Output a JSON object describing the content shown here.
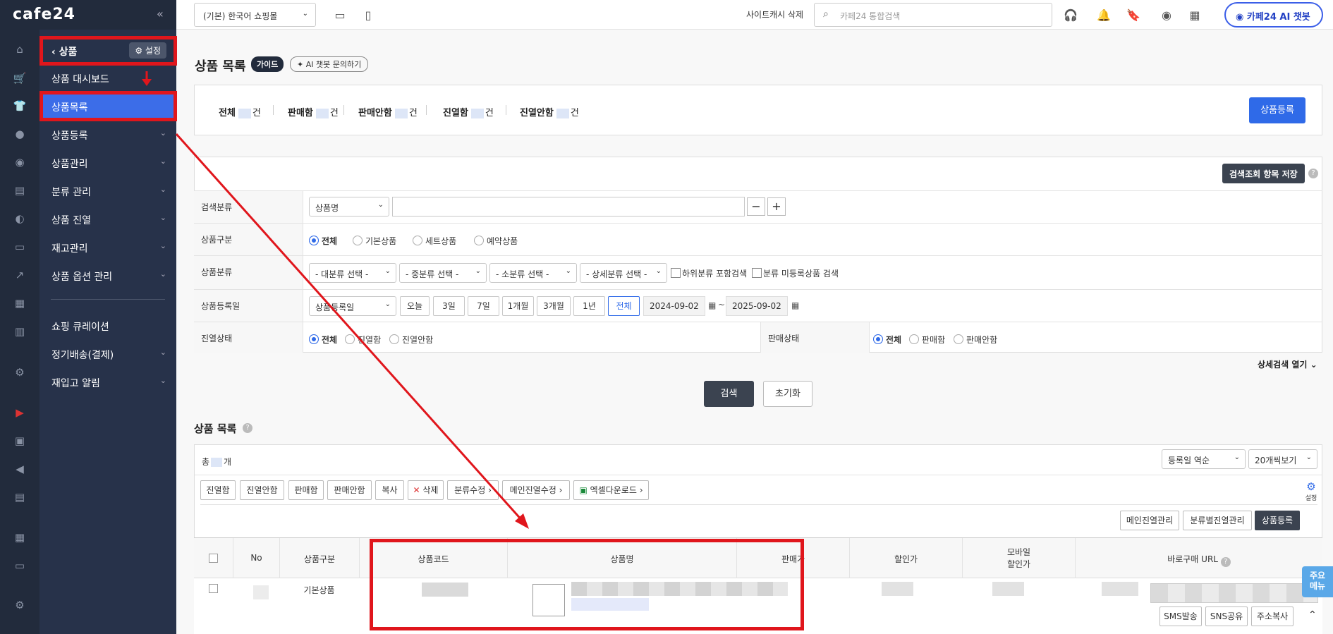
{
  "logo": "cafe24",
  "collapse_icon": "«",
  "topbar": {
    "shop_select": "(기본) 한국어 쇼핑몰",
    "cache_delete": "사이트캐시 삭제",
    "search_placeholder": "카페24 통합검색",
    "chatbot": "카페24 AI 챗봇"
  },
  "sidebar": {
    "header": "상품",
    "settings": "설정",
    "items": [
      {
        "label": "상품 대시보드"
      },
      {
        "label": "상품목록"
      },
      {
        "label": "상품등록"
      },
      {
        "label": "상품관리"
      },
      {
        "label": "분류 관리"
      },
      {
        "label": "상품 진열"
      },
      {
        "label": "재고관리"
      },
      {
        "label": "상품 옵션 관리"
      },
      {
        "label": "쇼핑 큐레이션"
      },
      {
        "label": "정기배송(결제)"
      },
      {
        "label": "재입고 알림"
      }
    ]
  },
  "page": {
    "title": "상품 목록",
    "guide": "가이드",
    "ai_chat": "AI 챗봇 문의하기"
  },
  "summary": {
    "total": "전체",
    "on_sale": "판매함",
    "not_on_sale": "판매안함",
    "displayed": "진열함",
    "not_displayed": "진열안함",
    "unit": "건",
    "register_button": "상품등록"
  },
  "search": {
    "save_button": "검색조회 항목 저장",
    "row_category_label": "검색분류",
    "category_select": "상품명",
    "row_type_label": "상품구분",
    "types": [
      "전체",
      "기본상품",
      "세트상품",
      "예약상품"
    ],
    "row_class_label": "상품분류",
    "class_selects": [
      "- 대분류 선택 -",
      "- 중분류 선택 -",
      "- 소분류 선택 -",
      "- 상세분류 선택 -"
    ],
    "include_sub": "하위분류 포함검색",
    "unclassified": "분류 미등록상품 검색",
    "row_date_label": "상품등록일",
    "date_select": "상품등록일",
    "periods": [
      "오늘",
      "3일",
      "7일",
      "1개월",
      "3개월",
      "1년",
      "전체"
    ],
    "date_from": "2024-09-02",
    "tilde": "~",
    "date_to": "2025-09-02",
    "row_display_label": "진열상태",
    "display_opts": [
      "전체",
      "진열함",
      "진열안함"
    ],
    "sale_label": "판매상태",
    "sale_opts": [
      "전체",
      "판매함",
      "판매안함"
    ],
    "advanced": "상세검색 열기",
    "search_button": "검색",
    "reset_button": "초기화"
  },
  "list": {
    "title": "상품 목록",
    "count_prefix": "총",
    "count_unit": "개",
    "sort_select": "등록일 역순",
    "page_size_select": "20개씩보기",
    "actions": [
      "진열함",
      "진열안함",
      "판매함",
      "판매안함",
      "복사",
      "삭제",
      "분류수정",
      "메인진열수정",
      "엑셀다운로드"
    ],
    "settings_label": "설정",
    "right_buttons": [
      "메인진열관리",
      "분류별진열관리",
      "상품등록"
    ],
    "columns": [
      "No",
      "상품구분",
      "상품코드",
      "상품명",
      "판매가",
      "할인가",
      "모바일\n할인가",
      "바로구매 URL"
    ],
    "row": {
      "type": "기본상품",
      "btn_sms": "SMS발송",
      "btn_sns": "SNS공유",
      "btn_copy": "주소복사"
    }
  },
  "float_menu": "주요\n메뉴"
}
